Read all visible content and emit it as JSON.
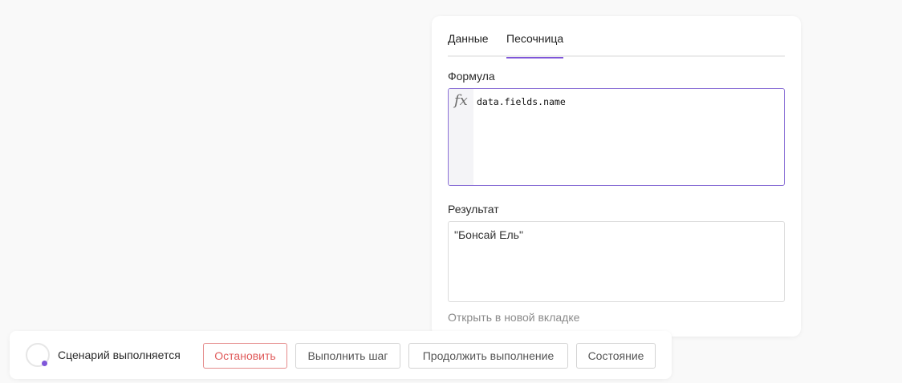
{
  "panel": {
    "tabs": [
      {
        "label": "Данные",
        "active": false
      },
      {
        "label": "Песочница",
        "active": true
      }
    ],
    "formula_label": "Формула",
    "formula_icon": "fx-icon",
    "formula_icon_glyph": "fx",
    "formula_value": "data.fields.name",
    "result_label": "Результат",
    "result_value": "\"Бонсай Ель\"",
    "open_link": "Открыть в новой вкладке"
  },
  "runbar": {
    "status": "Сценарий выполняется",
    "buttons": {
      "stop": "Остановить",
      "step": "Выполнить шаг",
      "continue": "Продолжить выполнение",
      "state": "Состояние"
    }
  },
  "colors": {
    "accent": "#7f56d9",
    "danger": "#e05b5b"
  }
}
